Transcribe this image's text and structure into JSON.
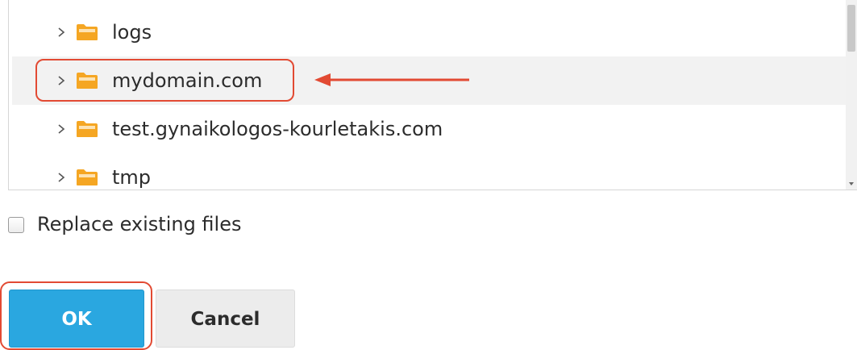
{
  "folder_tree": {
    "items": [
      {
        "label": "logs",
        "selected": false,
        "icon": "folder-icon"
      },
      {
        "label": "mydomain.com",
        "selected": true,
        "icon": "folder-icon"
      },
      {
        "label": "test.gynaikologos-kourletakis.com",
        "selected": false,
        "icon": "folder-icon"
      },
      {
        "label": "tmp",
        "selected": false,
        "icon": "folder-icon"
      }
    ]
  },
  "options": {
    "replace_label": "Replace existing files",
    "replace_checked": false
  },
  "buttons": {
    "ok_label": "OK",
    "cancel_label": "Cancel"
  },
  "colors": {
    "accent": "#2aa7e0",
    "annotation": "#e24a33",
    "folder": "#f5a623"
  }
}
